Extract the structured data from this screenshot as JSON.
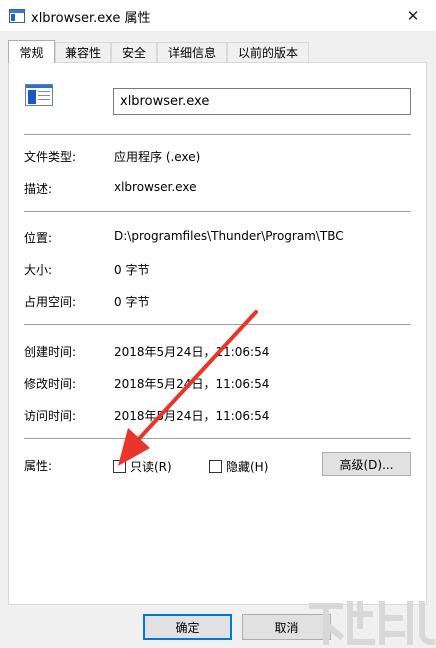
{
  "window": {
    "title": "xlbrowser.exe 属性",
    "close_glyph": "✕"
  },
  "tabs": [
    {
      "label": "常规",
      "active": true
    },
    {
      "label": "兼容性",
      "active": false
    },
    {
      "label": "安全",
      "active": false
    },
    {
      "label": "详细信息",
      "active": false
    },
    {
      "label": "以前的版本",
      "active": false
    }
  ],
  "general": {
    "file_name": "xlbrowser.exe",
    "file_type_label": "文件类型:",
    "file_type_value": "应用程序 (.exe)",
    "description_label": "描述:",
    "description_value": "xlbrowser.exe",
    "location_label": "位置:",
    "location_value": "D:\\programfiles\\Thunder\\Program\\TBC",
    "size_label": "大小:",
    "size_value": "0 字节",
    "size_on_disk_label": "占用空间:",
    "size_on_disk_value": "0 字节",
    "created_label": "创建时间:",
    "created_value": "2018年5月24日，11:06:54",
    "modified_label": "修改时间:",
    "modified_value": "2018年5月24日，11:06:54",
    "accessed_label": "访问时间:",
    "accessed_value": "2018年5月24日，11:06:54",
    "attributes_label": "属性:",
    "readonly_label": "只读(R)",
    "readonly_checked": false,
    "hidden_label": "隐藏(H)",
    "hidden_checked": false,
    "advanced_label": "高级(D)..."
  },
  "footer": {
    "ok_label": "确定",
    "cancel_label": "取消"
  },
  "colors": {
    "arrow": "#e8362c",
    "accent": "#0078d7",
    "watermark": "#dcdcdc"
  }
}
